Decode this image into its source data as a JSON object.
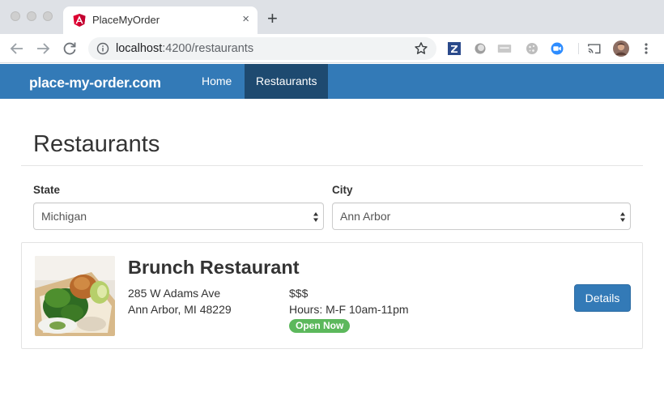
{
  "browser": {
    "tab_title": "PlaceMyOrder",
    "tab_close": "×",
    "new_tab": "+",
    "url_host": "localhost",
    "url_path": ":4200/restaurants",
    "extensions": [
      "zotero-icon",
      "circle-extension-icon",
      "gray-extension-icon",
      "cookie-extension-icon",
      "zoom-extension-icon",
      "cast-icon",
      "profile-avatar",
      "more-menu-icon"
    ]
  },
  "site": {
    "brand": "place-my-order.com",
    "nav": [
      {
        "label": "Home",
        "active": false
      },
      {
        "label": "Restaurants",
        "active": true
      }
    ],
    "colors": {
      "navbar": "#337ab7",
      "active_nav": "#1e4a70",
      "badge": "#5cb85c"
    }
  },
  "page": {
    "title": "Restaurants",
    "state_label": "State",
    "state_value": "Michigan",
    "city_label": "City",
    "city_value": "Ann Arbor"
  },
  "restaurant": {
    "name": "Brunch Restaurant",
    "address_line1": "285 W Adams Ave",
    "address_line2": "Ann Arbor, MI 48229",
    "price": "$$$",
    "hours": "Hours: M-F 10am-11pm",
    "status": "Open Now",
    "details_label": "Details"
  }
}
